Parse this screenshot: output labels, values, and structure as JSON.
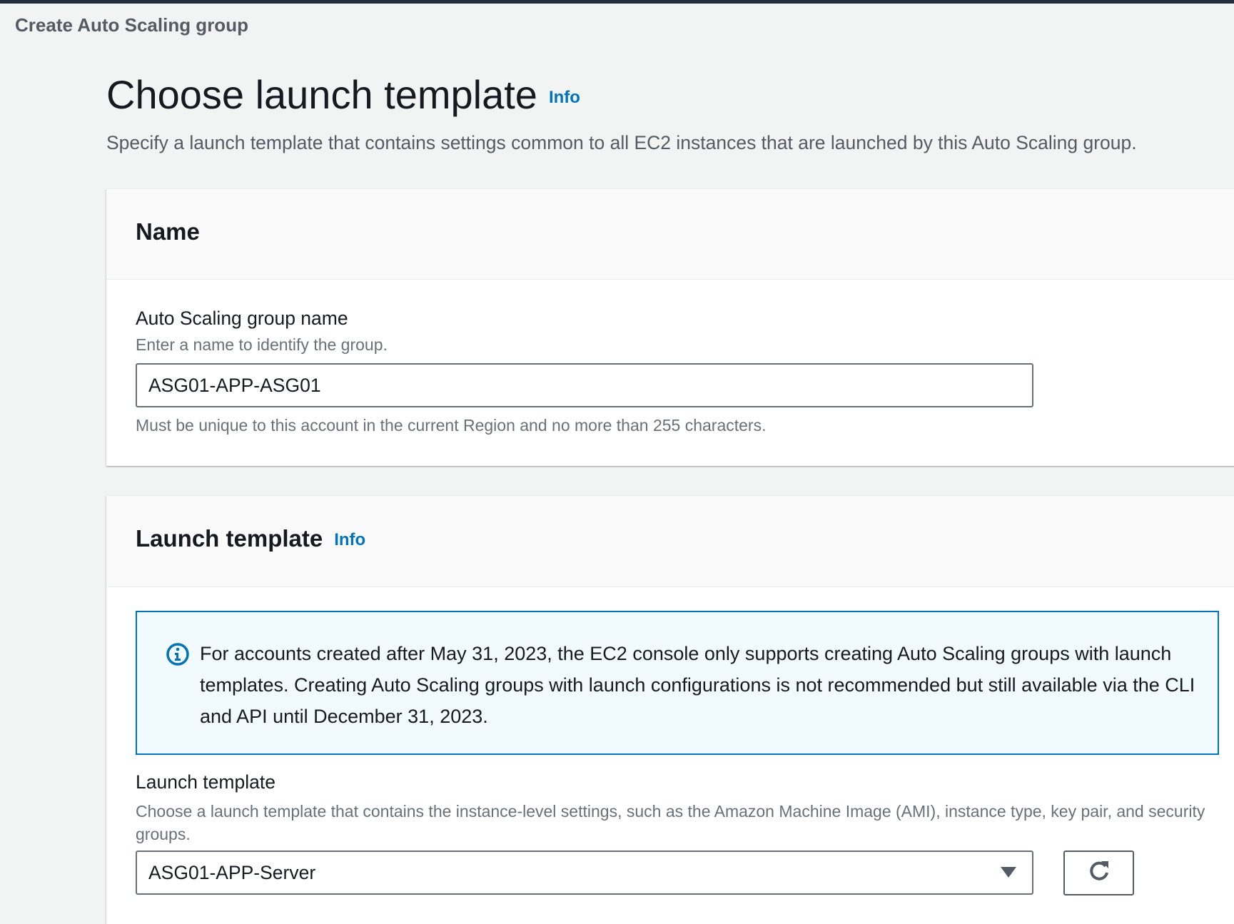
{
  "breadcrumb": "Create Auto Scaling group",
  "page": {
    "title": "Choose launch template",
    "info_label": "Info",
    "description": "Specify a launch template that contains settings common to all EC2 instances that are launched by this Auto Scaling group."
  },
  "name_section": {
    "heading": "Name",
    "field_label": "Auto Scaling group name",
    "field_hint": "Enter a name to identify the group.",
    "field_value": "ASG01-APP-ASG01",
    "constraint": "Must be unique to this account in the current Region and no more than 255 characters."
  },
  "launch_template_section": {
    "heading": "Launch template",
    "info_label": "Info",
    "alert_icon": "info-circle-icon",
    "alert_text": "For accounts created after May 31, 2023, the EC2 console only supports creating Auto Scaling groups with launch templates. Creating Auto Scaling groups with launch configurations is not recommended but still available via the CLI and API until December 31, 2023.",
    "field_label": "Launch template",
    "field_hint": "Choose a launch template that contains the instance-level settings, such as the Amazon Machine Image (AMI), instance type, key pair, and security groups.",
    "selected_value": "ASG01-APP-Server",
    "refresh_icon": "refresh-icon"
  },
  "colors": {
    "accent": "#0073bb",
    "alert_bg": "#f1faff",
    "topbar": "#232f3e"
  }
}
